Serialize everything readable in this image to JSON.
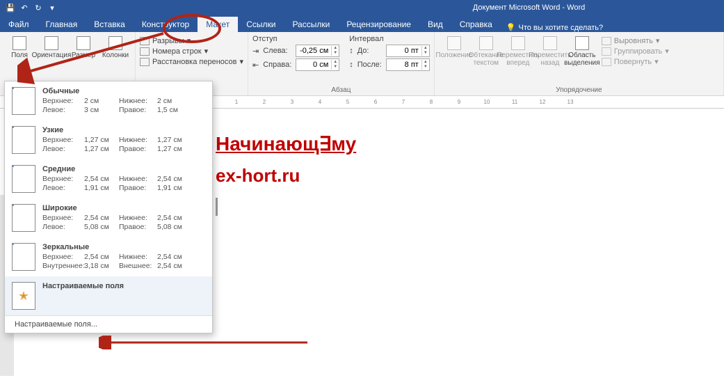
{
  "title": "Документ Microsoft Word  -  Word",
  "tabs": [
    "Файл",
    "Главная",
    "Вставка",
    "Конструктор",
    "Макет",
    "Ссылки",
    "Рассылки",
    "Рецензирование",
    "Вид",
    "Справка"
  ],
  "active_tab": "Макет",
  "tell_me": "Что вы хотите сделать?",
  "ribbon": {
    "page_setup": {
      "margins": "Поля",
      "orientation": "Ориентация",
      "size": "Размер",
      "columns": "Колонки",
      "breaks": "Разрывы",
      "line_numbers": "Номера строк",
      "hyphenation": "Расстановка переносов"
    },
    "indent": {
      "title": "Отступ",
      "left_label": "Слева:",
      "right_label": "Справа:",
      "left_value": "-0,25 см",
      "right_value": "0 см"
    },
    "spacing": {
      "title": "Интервал",
      "before_label": "До:",
      "after_label": "После:",
      "before_value": "0 пт",
      "after_value": "8 пт"
    },
    "paragraph_label": "Абзац",
    "arrange": {
      "position": "Положение",
      "wrap": "Обтекание текстом",
      "forward": "Переместить вперед",
      "backward": "Переместить назад",
      "selection_pane": "Область выделения",
      "align": "Выровнять",
      "group": "Группировать",
      "rotate": "Повернуть",
      "label": "Упорядочение"
    }
  },
  "margins_menu": {
    "presets": [
      {
        "name": "Обычные",
        "top_l": "Верхнее:",
        "top": "2 см",
        "bottom_l": "Нижнее:",
        "bottom": "2 см",
        "left_l": "Левое:",
        "left": "3 см",
        "right_l": "Правое:",
        "right": "1,5 см"
      },
      {
        "name": "Узкие",
        "top_l": "Верхнее:",
        "top": "1,27 см",
        "bottom_l": "Нижнее:",
        "bottom": "1,27 см",
        "left_l": "Левое:",
        "left": "1,27 см",
        "right_l": "Правое:",
        "right": "1,27 см"
      },
      {
        "name": "Средние",
        "top_l": "Верхнее:",
        "top": "2,54 см",
        "bottom_l": "Нижнее:",
        "bottom": "2,54 см",
        "left_l": "Левое:",
        "left": "1,91 см",
        "right_l": "Правое:",
        "right": "1,91 см"
      },
      {
        "name": "Широкие",
        "top_l": "Верхнее:",
        "top": "2,54 см",
        "bottom_l": "Нижнее:",
        "bottom": "2,54 см",
        "left_l": "Левое:",
        "left": "5,08 см",
        "right_l": "Правое:",
        "right": "5,08 см"
      },
      {
        "name": "Зеркальные",
        "top_l": "Верхнее:",
        "top": "2,54 см",
        "bottom_l": "Нижнее:",
        "bottom": "2,54 см",
        "left_l": "Внутреннее:",
        "left": "3,18 см",
        "right_l": "Внешнее:",
        "right": "2,54 см"
      }
    ],
    "last_used": "Настраиваемые поля",
    "custom": "Настраиваемые поля..."
  },
  "document": {
    "line1": "Начинающ∃му",
    "line2": "ex-hort.ru"
  },
  "ruler_ticks": [
    "1",
    "2",
    "3",
    "4",
    "5",
    "6",
    "7",
    "8",
    "9",
    "10",
    "11",
    "12",
    "13"
  ]
}
